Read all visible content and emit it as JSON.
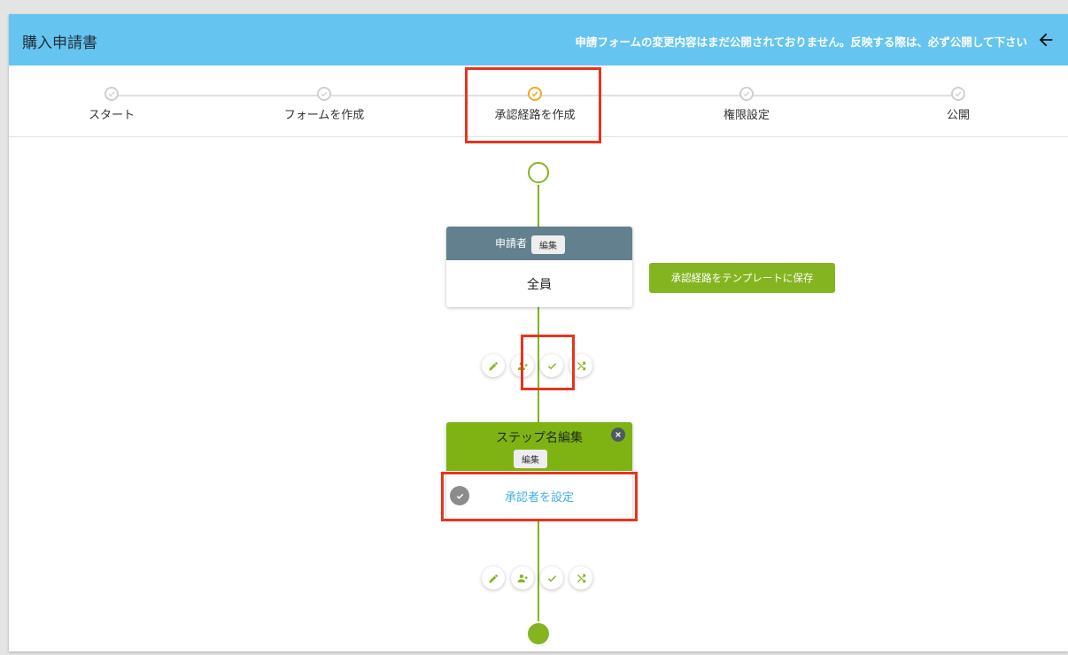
{
  "header": {
    "title": "購入申請書",
    "notice": "申請フォームの変更内容はまだ公開されておりません。反映する際は、必ず公開して下さい"
  },
  "stepper": {
    "steps": [
      {
        "label": "スタート",
        "active": false
      },
      {
        "label": "フォームを作成",
        "active": false
      },
      {
        "label": "承認経路を作成",
        "active": true
      },
      {
        "label": "権限設定",
        "active": false
      },
      {
        "label": "公開",
        "active": false
      }
    ]
  },
  "applicant_card": {
    "title": "申請者",
    "edit_label": "編集",
    "value": "全員"
  },
  "save_template_label": "承認経路をテンプレートに保存",
  "step_card": {
    "title": "ステップ名編集",
    "edit_label": "編集",
    "set_approver_label": "承認者を設定"
  },
  "action_icons": [
    "pencil-icon",
    "add-user-icon",
    "check-icon",
    "shuffle-icon"
  ],
  "colors": {
    "header_bg": "#66c5f0",
    "accent_green": "#84b521",
    "step_card_head": "#7fb314",
    "applicant_head": "#62808e",
    "active_step": "#f5a623",
    "link_blue": "#45aee3",
    "highlight_red": "#e8341c"
  }
}
